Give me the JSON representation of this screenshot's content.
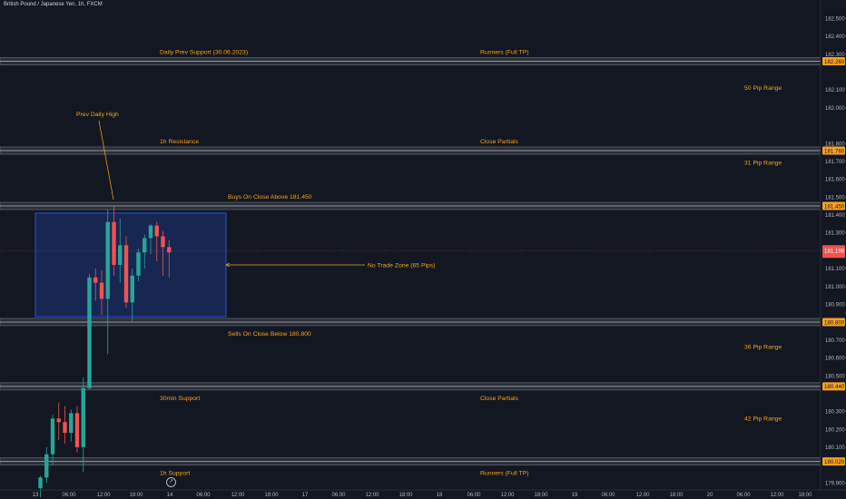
{
  "symbol_title": "British Pound / Japanese Yen, 1h, FXCM",
  "gear_glyph": "↗",
  "colors": {
    "background": "#131722",
    "up": "#26a69a",
    "down": "#ef5350",
    "level_band": "#434651",
    "label": "#f7a21b",
    "axis_text": "#b2b5be",
    "zone_fill": "rgba(41,98,255,0.22)",
    "zone_border": "#2962ff",
    "price_tag": "#f7a21b",
    "current_price_tag": "#ef5350"
  },
  "chart_data": {
    "type": "candlestick",
    "y_ticks": [
      "181.400",
      "181.300",
      "181.100",
      "181.000",
      "180.900",
      "180.700",
      "180.600",
      "180.500",
      "180.300",
      "180.200",
      "180.100",
      "179.900",
      "182.400",
      "182.300",
      "182.100",
      "182.000",
      "181.900",
      "181.800",
      "181.700",
      "181.600",
      "181.500",
      "182.500"
    ],
    "y_ticks_visible": [
      {
        "value": 182.5,
        "label": "182.500"
      },
      {
        "value": 182.4,
        "label": "182.400"
      },
      {
        "value": 182.3,
        "label": "182.300"
      },
      {
        "value": 182.1,
        "label": "182.100"
      },
      {
        "value": 182.0,
        "label": "182.000"
      },
      {
        "value": 181.8,
        "label": "181.800"
      },
      {
        "value": 181.7,
        "label": "181.700"
      },
      {
        "value": 181.6,
        "label": "181.600"
      },
      {
        "value": 181.5,
        "label": "181.500"
      },
      {
        "value": 181.4,
        "label": "181.400"
      },
      {
        "value": 181.3,
        "label": "181.300"
      },
      {
        "value": 181.1,
        "label": "181.100"
      },
      {
        "value": 181.0,
        "label": "181.000"
      },
      {
        "value": 180.9,
        "label": "180.900"
      },
      {
        "value": 180.7,
        "label": "180.700"
      },
      {
        "value": 180.6,
        "label": "180.600"
      },
      {
        "value": 180.5,
        "label": "180.500"
      },
      {
        "value": 180.3,
        "label": "180.300"
      },
      {
        "value": 180.2,
        "label": "180.200"
      },
      {
        "value": 180.1,
        "label": "180.100"
      },
      {
        "value": 179.9,
        "label": "179.900"
      }
    ],
    "x_ticks": [
      "13",
      "06:00",
      "12:00",
      "18:00",
      "14",
      "06:00",
      "12:00",
      "18:00",
      "17",
      "06:00",
      "12:00",
      "18:00",
      "18",
      "06:00",
      "12:00",
      "18:00",
      "19",
      "06:00",
      "12:00",
      "18:00",
      "20",
      "06:00",
      "12:00",
      "18:00"
    ],
    "ylim": [
      179.85,
      182.55
    ],
    "levels": [
      {
        "price": 182.26,
        "tag": "182.260",
        "left_label": "Daily Prev Support (30.06.2023)",
        "right_label": "Runners (Full TP)"
      },
      {
        "price": 181.76,
        "tag": "181.760",
        "left_label": "1h Resistance",
        "right_label": "Close Partials"
      },
      {
        "price": 181.45,
        "tag": "181.450",
        "left_label": "Buys On Close Above 181.450",
        "right_label": ""
      },
      {
        "price": 180.8,
        "tag": "180.800",
        "left_label": "Sells On Close Below 180.800",
        "right_label": ""
      },
      {
        "price": 180.44,
        "tag": "180.440",
        "left_label": "30min Support",
        "right_label": "Close Partials"
      },
      {
        "price": 180.02,
        "tag": "180.020",
        "left_label": "1h Support",
        "right_label": "Runners (Full TP)"
      }
    ],
    "ranges": [
      {
        "label": "50 Pip Range",
        "price": 182.11
      },
      {
        "label": "31 Pip Range",
        "price": 181.69
      },
      {
        "label": "36 Pip Range",
        "price": 180.66
      },
      {
        "label": "42 Pip Range",
        "price": 180.26
      }
    ],
    "no_trade_zone": {
      "label": "No Trade Zone (65 Pips)",
      "top": 181.41,
      "bottom": 180.83
    },
    "annotation": {
      "label": "Prev Daily High"
    },
    "current_price": {
      "value": 181.2,
      "tag": "181.198"
    },
    "candles": [
      {
        "o": 179.87,
        "h": 179.94,
        "l": 179.82,
        "c": 179.93
      },
      {
        "o": 179.93,
        "h": 180.1,
        "l": 179.9,
        "c": 180.06
      },
      {
        "o": 180.06,
        "h": 180.28,
        "l": 180.0,
        "c": 180.26
      },
      {
        "o": 180.26,
        "h": 180.35,
        "l": 180.14,
        "c": 180.24
      },
      {
        "o": 180.24,
        "h": 180.33,
        "l": 180.12,
        "c": 180.18
      },
      {
        "o": 180.18,
        "h": 180.31,
        "l": 180.13,
        "c": 180.29
      },
      {
        "o": 180.29,
        "h": 180.33,
        "l": 180.07,
        "c": 180.1
      },
      {
        "o": 180.1,
        "h": 180.49,
        "l": 179.96,
        "c": 180.43
      },
      {
        "o": 180.43,
        "h": 181.07,
        "l": 180.42,
        "c": 181.05
      },
      {
        "o": 181.05,
        "h": 181.1,
        "l": 180.92,
        "c": 181.02
      },
      {
        "o": 181.02,
        "h": 181.09,
        "l": 180.84,
        "c": 180.93
      },
      {
        "o": 180.93,
        "h": 181.43,
        "l": 180.62,
        "c": 181.36
      },
      {
        "o": 181.36,
        "h": 181.45,
        "l": 181.06,
        "c": 181.12
      },
      {
        "o": 181.12,
        "h": 181.38,
        "l": 181.02,
        "c": 181.23
      },
      {
        "o": 181.23,
        "h": 181.28,
        "l": 180.88,
        "c": 180.91
      },
      {
        "o": 180.91,
        "h": 181.1,
        "l": 180.8,
        "c": 181.06
      },
      {
        "o": 181.06,
        "h": 181.21,
        "l": 181.03,
        "c": 181.19
      },
      {
        "o": 181.19,
        "h": 181.29,
        "l": 181.1,
        "c": 181.27
      },
      {
        "o": 181.27,
        "h": 181.35,
        "l": 181.18,
        "c": 181.34
      },
      {
        "o": 181.34,
        "h": 181.36,
        "l": 181.14,
        "c": 181.28
      },
      {
        "o": 181.28,
        "h": 181.31,
        "l": 181.06,
        "c": 181.22
      },
      {
        "o": 181.22,
        "h": 181.26,
        "l": 181.05,
        "c": 181.19
      }
    ]
  }
}
